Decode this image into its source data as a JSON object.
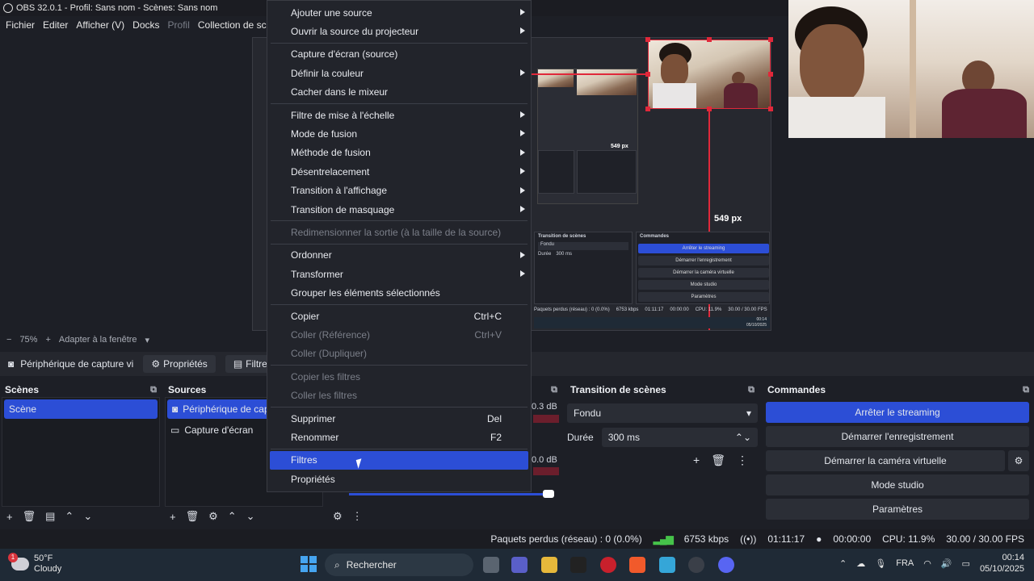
{
  "window": {
    "title": "OBS 32.0.1 - Profil: Sans nom - Scènes: Sans nom"
  },
  "menubar": [
    "Fichier",
    "Editer",
    "Afficher (V)",
    "Docks",
    "Profil",
    "Collection de scè"
  ],
  "preview": {
    "zoom": "75%",
    "fit_label": "Adapter à la fenêtre",
    "px_labels": [
      "549 px",
      "549 px"
    ],
    "mini": {
      "transition_title": "Transition de scènes",
      "transition_value": "Fondu",
      "duration_label": "Durée",
      "duration_value": "300 ms",
      "commands_title": "Commandes",
      "buttons": [
        "Arrêter le streaming",
        "Démarrer l'enregistrement",
        "Démarrer la caméra virtuelle",
        "Mode studio",
        "Paramètres"
      ],
      "status": "Paquets perdus (réseau) : 0 (0.0%)",
      "kbps": "6753 kbps",
      "time": "01:11:17",
      "rec_time": "00:00:00",
      "cpu": "CPU: 11.9%",
      "fps": "30.00 / 30.00 FPS",
      "clock_time": "00:14",
      "clock_date": "05/10/2025"
    }
  },
  "context_bar": {
    "device": "Périphérique de capture vi",
    "properties": "Propriétés",
    "filters": "Filtres"
  },
  "scenes": {
    "title": "Scènes",
    "items": [
      "Scène"
    ]
  },
  "sources": {
    "title": "Sources",
    "items": [
      "Périphérique de cap",
      "Capture d'écran"
    ]
  },
  "mixer": {
    "db1": "0.3 dB",
    "db2": "0.0 dB"
  },
  "transition": {
    "title": "Transition de scènes",
    "value": "Fondu",
    "duration_label": "Durée",
    "duration_value": "300 ms"
  },
  "commands": {
    "title": "Commandes",
    "stop_stream": "Arrêter le streaming",
    "start_rec": "Démarrer l'enregistrement",
    "start_vcam": "Démarrer la caméra virtuelle",
    "studio": "Mode studio",
    "settings": "Paramètres"
  },
  "status": {
    "dropped": "Paquets perdus (réseau) : 0 (0.0%)",
    "kbps": "6753 kbps",
    "live_time": "01:11:17",
    "rec_time": "00:00:00",
    "cpu": "CPU: 11.9%",
    "fps": "30.00 / 30.00 FPS"
  },
  "context_menu": {
    "items": [
      {
        "label": "Ajouter une source",
        "sub": true
      },
      {
        "label": "Ouvrir la source du projecteur",
        "sub": true
      },
      {
        "label": "Capture d'écran (source)"
      },
      {
        "label": "Définir la couleur",
        "sub": true
      },
      {
        "label": "Cacher dans le mixeur"
      },
      {
        "label": "Filtre de mise à l'échelle",
        "sub": true
      },
      {
        "label": "Mode de fusion",
        "sub": true
      },
      {
        "label": "Méthode de fusion",
        "sub": true
      },
      {
        "label": "Désentrelacement",
        "sub": true
      },
      {
        "label": "Transition à l'affichage",
        "sub": true
      },
      {
        "label": "Transition de masquage",
        "sub": true
      },
      {
        "label": "Redimensionner la sortie (à la taille de la source)"
      },
      {
        "label": "Ordonner",
        "sub": true
      },
      {
        "label": "Transformer",
        "sub": true
      },
      {
        "label": "Grouper les éléments sélectionnés"
      },
      {
        "label": "Copier",
        "shortcut": "Ctrl+C"
      },
      {
        "label": "Coller (Référence)",
        "shortcut": "Ctrl+V"
      },
      {
        "label": "Coller (Dupliquer)"
      },
      {
        "label": "Copier les filtres"
      },
      {
        "label": "Coller les filtres"
      },
      {
        "label": "Supprimer",
        "shortcut": "Del"
      },
      {
        "label": "Renommer",
        "shortcut": "F2"
      },
      {
        "label": "Filtres"
      },
      {
        "label": "Propriétés"
      }
    ]
  },
  "taskbar": {
    "temp": "50°F",
    "weather": "Cloudy",
    "weather_badge": "1",
    "search_placeholder": "Rechercher",
    "lang": "FRA",
    "time": "00:14",
    "date": "05/10/2025"
  },
  "colors": {
    "accent": "#2c4ed6",
    "selection": "#e0283a",
    "bg": "#1d1f26"
  }
}
